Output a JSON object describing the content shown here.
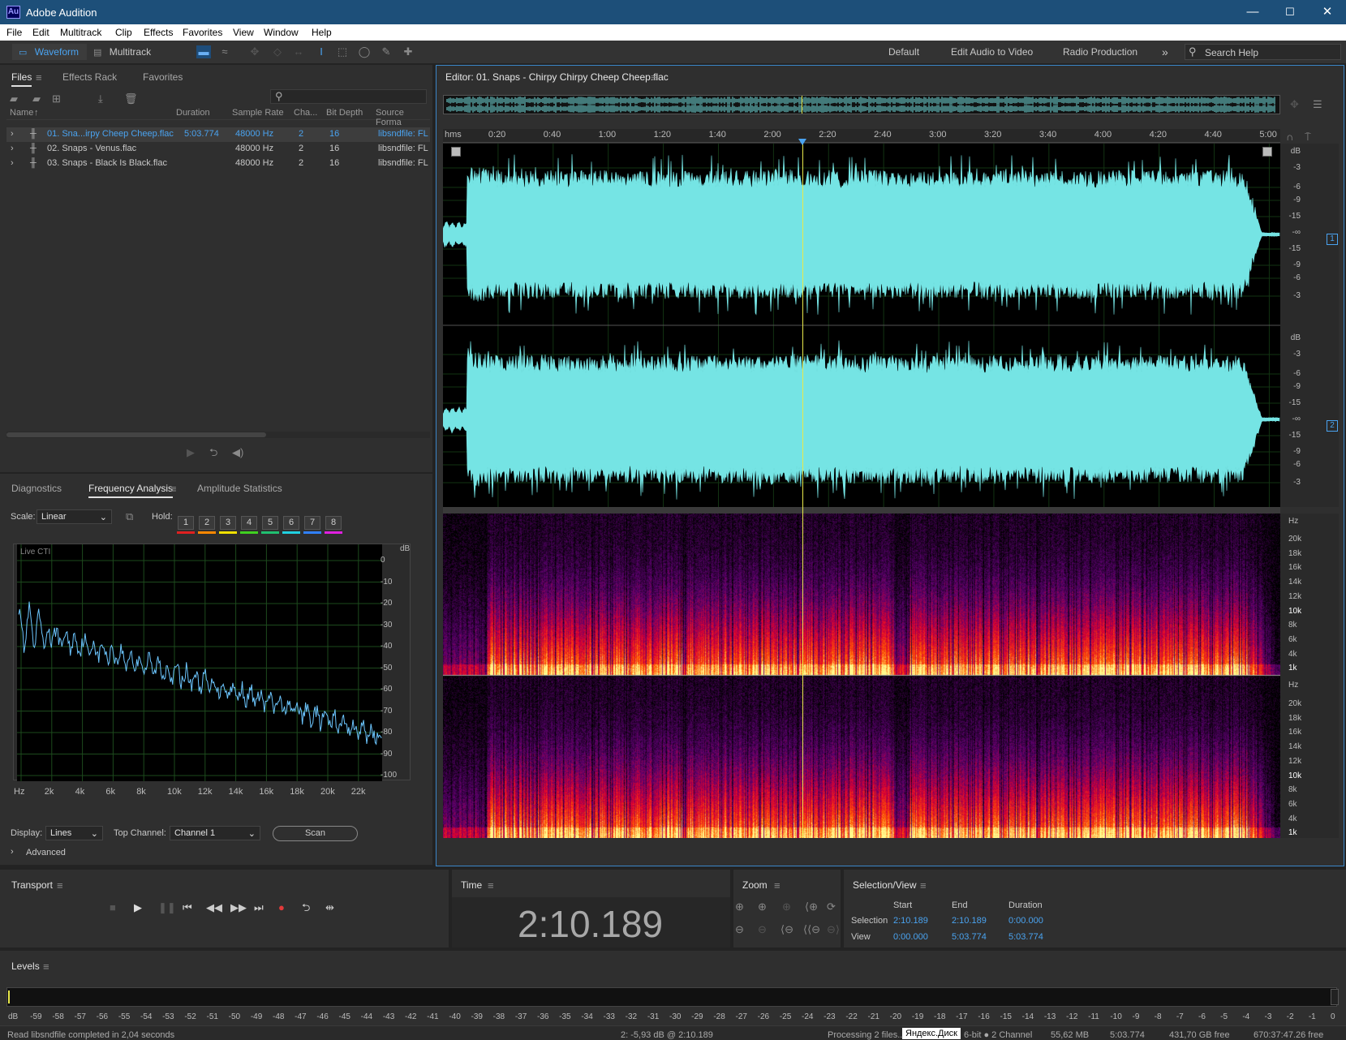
{
  "window": {
    "title": "Adobe Audition",
    "logo": "Au",
    "minimize": "—",
    "maximize": "☐",
    "close": "✕"
  },
  "menu": [
    "File",
    "Edit",
    "Multitrack",
    "Clip",
    "Effects",
    "Favorites",
    "View",
    "Window",
    "Help"
  ],
  "toolbar": {
    "waveform_label": "Waveform",
    "multitrack_label": "Multitrack",
    "workspaces": [
      "Default",
      "Edit Audio to Video",
      "Radio Production"
    ],
    "more": "»",
    "search_placeholder": "Search Help"
  },
  "files_panel": {
    "tabs": [
      "Files",
      "Effects Rack",
      "Favorites"
    ],
    "columns": [
      "Name",
      "Duration",
      "Sample Rate",
      "Cha...",
      "Bit Depth",
      "Source Forma"
    ],
    "rows": [
      {
        "name": "01. Sna...irpy Cheep Cheep.flac",
        "duration": "5:03.774",
        "rate": "48000 Hz",
        "ch": "2",
        "bits": "16",
        "fmt": "libsndfile: FL"
      },
      {
        "name": "02. Snaps - Venus.flac",
        "duration": "",
        "rate": "48000 Hz",
        "ch": "2",
        "bits": "16",
        "fmt": "libsndfile: FL"
      },
      {
        "name": "03. Snaps - Black Is Black.flac",
        "duration": "",
        "rate": "48000 Hz",
        "ch": "2",
        "bits": "16",
        "fmt": "libsndfile: FL"
      }
    ]
  },
  "freq_panel": {
    "tabs": [
      "Diagnostics",
      "Frequency Analysis",
      "Amplitude Statistics"
    ],
    "scale_label": "Scale:",
    "scale_value": "Linear",
    "hold_label": "Hold:",
    "hold": [
      "1",
      "2",
      "3",
      "4",
      "5",
      "6",
      "7",
      "8"
    ],
    "hold_colors": [
      "#e02020",
      "#ff8800",
      "#f0e000",
      "#40d020",
      "#20c070",
      "#20d0e0",
      "#3080ff",
      "#e020e0"
    ],
    "live_label": "Live CTI",
    "db_unit": "dB",
    "db_ticks": [
      "0",
      "-10",
      "-20",
      "-30",
      "-40",
      "-50",
      "-60",
      "-70",
      "-80",
      "-90",
      "-100"
    ],
    "x_ticks": [
      "Hz",
      "2k",
      "4k",
      "6k",
      "8k",
      "10k",
      "12k",
      "14k",
      "16k",
      "18k",
      "20k",
      "22k"
    ],
    "display_label": "Display:",
    "display_value": "Lines",
    "topchannel_label": "Top Channel:",
    "topchannel_value": "Channel 1",
    "scan_label": "Scan",
    "advanced_label": "Advanced"
  },
  "editor": {
    "title": "Editor: 01. Snaps - Chirpy Chirpy Cheep Cheep.flac",
    "time_unit": "hms",
    "time_ticks": [
      "0:20",
      "0:40",
      "1:00",
      "1:20",
      "1:40",
      "2:00",
      "2:20",
      "2:40",
      "3:00",
      "3:20",
      "3:40",
      "4:00",
      "4:20",
      "4:40",
      "5:00"
    ],
    "playhead_fraction": 0.4291,
    "amp_unit": "dB",
    "amp_ticks": [
      "-3",
      "-6",
      "-9",
      "-15",
      "-∞",
      "-15",
      "-9",
      "-6",
      "-3"
    ],
    "channel_1": "1",
    "channel_2": "2",
    "hz_unit": "Hz",
    "hz_ticks": [
      "20k",
      "18k",
      "16k",
      "14k",
      "12k",
      "10k",
      "8k",
      "6k",
      "4k",
      "1k"
    ]
  },
  "transport": {
    "title": "Transport"
  },
  "time_panel": {
    "title": "Time",
    "value": "2:10.189"
  },
  "zoom_panel": {
    "title": "Zoom"
  },
  "selview": {
    "title": "Selection/View",
    "headers": [
      "Start",
      "End",
      "Duration"
    ],
    "selection_label": "Selection",
    "view_label": "View",
    "selection": [
      "2:10.189",
      "2:10.189",
      "0:00.000"
    ],
    "view": [
      "0:00.000",
      "5:03.774",
      "5:03.774"
    ]
  },
  "levels": {
    "title": "Levels",
    "scale": [
      "dB",
      "-59",
      "-58",
      "-57",
      "-56",
      "-55",
      "-54",
      "-53",
      "-52",
      "-51",
      "-50",
      "-49",
      "-48",
      "-47",
      "-46",
      "-45",
      "-44",
      "-43",
      "-42",
      "-41",
      "-40",
      "-39",
      "-38",
      "-37",
      "-36",
      "-35",
      "-34",
      "-33",
      "-32",
      "-31",
      "-30",
      "-29",
      "-28",
      "-27",
      "-26",
      "-25",
      "-24",
      "-23",
      "-22",
      "-21",
      "-20",
      "-19",
      "-18",
      "-17",
      "-16",
      "-15",
      "-14",
      "-13",
      "-12",
      "-11",
      "-10",
      "-9",
      "-8",
      "-7",
      "-6",
      "-5",
      "-4",
      "-3",
      "-2",
      "-1",
      "0"
    ]
  },
  "status": {
    "left": "Read libsndfile completed in 2,04 seconds",
    "cursor": "2: -5,93 dB @ 2:10.189",
    "processing": "Processing 2 files...",
    "tooltip": "Яндекс.Диск",
    "format": "6-bit ● 2 Channel",
    "size": "55,62 MB",
    "duration": "5:03.774",
    "free": "431,70 GB free",
    "free_time": "670:37:47.26 free"
  },
  "colors": {
    "accent": "#4aa3f0",
    "waveform": "#75e4e4",
    "playhead": "#e8e84a",
    "titlebar": "#1d4f79"
  }
}
